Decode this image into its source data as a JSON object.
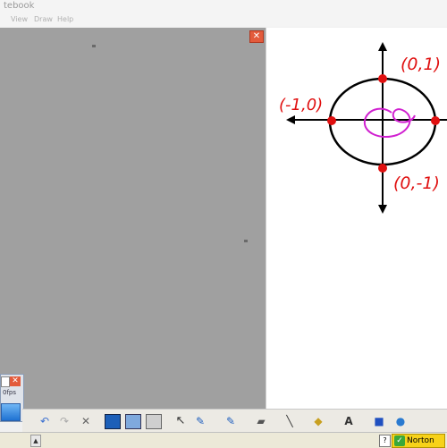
{
  "window": {
    "title": "tebook"
  },
  "menu": {
    "items": [
      "View",
      "Draw",
      "Help"
    ]
  },
  "gray_panel": {
    "close_label": "✕"
  },
  "whiteboard": {
    "labels": {
      "top": "(0,1)",
      "left": "(-1,0)",
      "bottom": "(0,-1)"
    },
    "colors": {
      "ink": "#000000",
      "points": "#e01010",
      "labels": "#e01010",
      "scribble": "#d020d0"
    }
  },
  "mini_window": {
    "fps_label": "0fps",
    "close_label": "✕"
  },
  "toolbar": {
    "icons": [
      "undo-icon",
      "redo-icon",
      "delete-icon",
      "screen-shade-icon",
      "table-icon",
      "insert-image-icon",
      "select-arrow-icon",
      "pen-icon",
      "creative-pen-icon",
      "eraser-icon",
      "line-icon",
      "fill-icon",
      "text-icon",
      "shape-icon",
      "magic-pen-icon"
    ]
  },
  "taskbar": {
    "help_label": "?",
    "norton_label": "Norton"
  }
}
